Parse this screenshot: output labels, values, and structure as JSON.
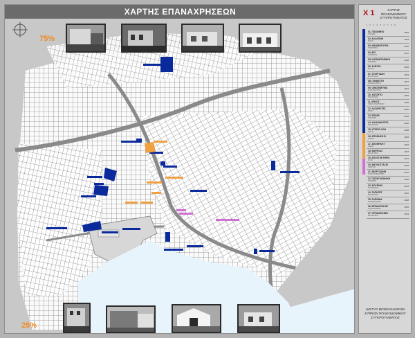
{
  "map": {
    "title": "ΧΑΡΤΗΣ ΕΠΑΝΑΧΡΗΣΕΩΝ",
    "scale_top": "75%",
    "scale_bottom": "25%",
    "icons": {
      "north": "compass-icon"
    },
    "colors": {
      "reuse_blue": "#0a2a9c",
      "reuse_orange": "#f0a040",
      "reuse_magenta": "#d070d0",
      "sea": "#e8f4fc",
      "land": "#d0d0d0",
      "blocks": "#f2f2f2"
    }
  },
  "legend": {
    "code": "X 1",
    "header": "ΧΑΡΤΗΣ ΠΟΛΕΟΔΟΜΙΚΟΥ ΣΥΓΚΡΟΤΗΜΑΤΟΣ",
    "ruler": "1 2 3 4 5 6 7 8 9",
    "items": [
      {
        "name": "01. ΠΑΠΑΦΕΙΟ",
        "sub": "ΣΧΟΛΕΙΟ",
        "year": "2006"
      },
      {
        "name": "02. ΑΛΛΑΤΙΝΗ",
        "sub": "ΜΥΛΟΙ",
        "year": "2004"
      },
      {
        "name": "03. ΜΑΝΙΦΑΤΟΥΡΑ",
        "sub": "ΥΦΑΝΤΗΡΙΟ",
        "year": "2002"
      },
      {
        "name": "04. ΦΙΞ",
        "sub": "ΖΥΘΟΠΟΙΙΑ",
        "year": "2011"
      },
      {
        "name": "05. ΚΑΠΝΑΠΟΘΗΚΗ",
        "sub": "ΑΠΟΘΗΚΗ",
        "year": "2008"
      },
      {
        "name": "06. ΑΛΕΥΡΑ",
        "sub": "ΜΥΛΟΣ",
        "year": "2005"
      },
      {
        "name": "07. ΣΤΕΡΓΙΑΔΗ",
        "sub": "ΕΡΓΟΣΤΑΣΙΟ",
        "year": "2003"
      },
      {
        "name": "08. ΓΙΑΝΝΙΤΣΗ",
        "sub": "ΚΑΠΝΑΠΟΘΗΚΗ",
        "year": "2007"
      },
      {
        "name": "09. ΟΙΝΟΠΝΕΥΜΑ",
        "sub": "ΑΠΟΣΤΑΚΤΗΡΙΟ",
        "year": "2001"
      },
      {
        "name": "10. ΧΑΤΖΗΤΟ",
        "sub": "ΠΑΓΟΠΟΙΕΙΟ",
        "year": "2009"
      },
      {
        "name": "11. ΜΥΛΟΣ",
        "sub": "ΧΩΡΟΣ ΠΟΛΙΤΙΣΜΟΥ",
        "year": "2000"
      },
      {
        "name": "12. ΛΑΖΑΡΙΣΤΕΣ",
        "sub": "ΜΟΝΗ",
        "year": "2006"
      },
      {
        "name": "13. ΕΠΑΡΚ",
        "sub": "ΑΠΟΘΗΚΗ",
        "year": "2004"
      },
      {
        "name": "14. ΧΑΛΚΙΝΑ ΕΡΓΑ",
        "sub": "ΕΡΓΟΣΤΑΣΙΟ",
        "year": "2002"
      },
      {
        "name": "15. ΚΤΗΡΙΟ ΟΛΘ",
        "sub": "ΛΙΜΑΝΙ",
        "year": "2008"
      },
      {
        "name": "16. ΑΠΟΘΗΚΗ Β",
        "sub": "ΛΙΜΑΝΙ",
        "year": "2005"
      },
      {
        "name": "17. ΑΠΟΘΗΚΗ Γ",
        "sub": "ΛΙΜΑΝΙ",
        "year": "2003"
      },
      {
        "name": "18. ΒΑΡΕΛΑΣ",
        "sub": "ΕΡΓΑΣΤΗΡΙΟ",
        "year": "2007"
      },
      {
        "name": "19. ΑΠΟΣΤΑΚΤΗΡΙΟ",
        "sub": "ΟΥΖΟ",
        "year": "2001"
      },
      {
        "name": "20. ΑΝΤΛΙΟΣΤΑΣΙΟ",
        "sub": "ΥΔΡΕΥΣΗ",
        "year": "2009"
      },
      {
        "name": "21. ΦΙΟΡΤΖΙΑΝΗ",
        "sub": "ΚΛΩΣΤΟΥΦΑΝΤΗΡΙΟ",
        "year": "2010"
      },
      {
        "name": "22. ΠΑΠΑΓΙΑΝΝΑΚΗ",
        "sub": "ΑΠΟΘΗΚΗ",
        "year": "2006"
      },
      {
        "name": "23. ΦΟΥΡΝΟΙ",
        "sub": "ΑΡΤΟΠΟΙΕΙΟ",
        "year": "2004"
      },
      {
        "name": "24. ΤΑΠΗΤΕΣ",
        "sub": "ΕΡΓΟΣΤΑΣΙΟ",
        "year": "2002"
      },
      {
        "name": "25. ΣΑΠΩΝΙΑ",
        "sub": "ΣΑΠΩΝΟΠΟΙΕΙΟ",
        "year": "2008"
      },
      {
        "name": "26. ΜΠΟΔΟΣΑΚΗΣ",
        "sub": "ΚΑΠΝΑΠΟΘΗΚΗ",
        "year": "2005"
      },
      {
        "name": "27. ΟΡΓΑΝΟΣΗΜΟ",
        "sub": "ΕΡΓΑΣΤΗΡΙΟ",
        "year": "2003"
      }
    ],
    "footer": "ΔΙΚΤΥΟ ΒΙΟΜΗΧΑΝΙΚΩΝ ΚΤΙΡΙΩΝ ΠΟΛΕΟΔΟΜΙΚΟΥ ΣΥΓΚΡΟΤΗΜΑΤΟΣ"
  }
}
